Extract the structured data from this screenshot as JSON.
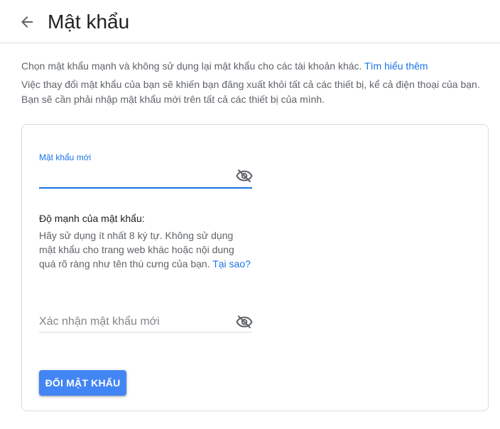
{
  "header": {
    "title": "Mật khẩu",
    "back_icon": "arrow-back-icon"
  },
  "intro": {
    "line1_text": "Chọn mật khẩu mạnh và không sử dụng lại mật khẩu cho các tài khoản khác.",
    "learn_more_link": "Tìm hiểu thêm",
    "line2_text": "Việc thay đổi mật khẩu của bạn sẽ khiến bạn đăng xuất khỏi tất cả các thiết bị, kể cả điện thoại của bạn. Bạn sẽ cần phải nhập mật khẩu mới trên tất cả các thiết bị của mình."
  },
  "form": {
    "new_password_label": "Mật khẩu mới",
    "new_password_value": "",
    "strength_title": "Độ mạnh của mật khẩu:",
    "strength_text": "Hãy sử dụng ít nhất 8 ký tự. Không sử dụng mật khẩu cho trang web khác hoặc nội dung quá rõ ràng như tên thú cưng của bạn.",
    "why_link": "Tại sao?",
    "confirm_password_placeholder": "Xác nhận mật khẩu mới",
    "visibility_icon": "visibility-off-icon",
    "submit_label": "ĐỔI MẬT KHẨU"
  },
  "colors": {
    "accent": "#1a73e8",
    "button": "#4285f4",
    "text_primary": "#202124",
    "text_secondary": "#5f6368"
  }
}
